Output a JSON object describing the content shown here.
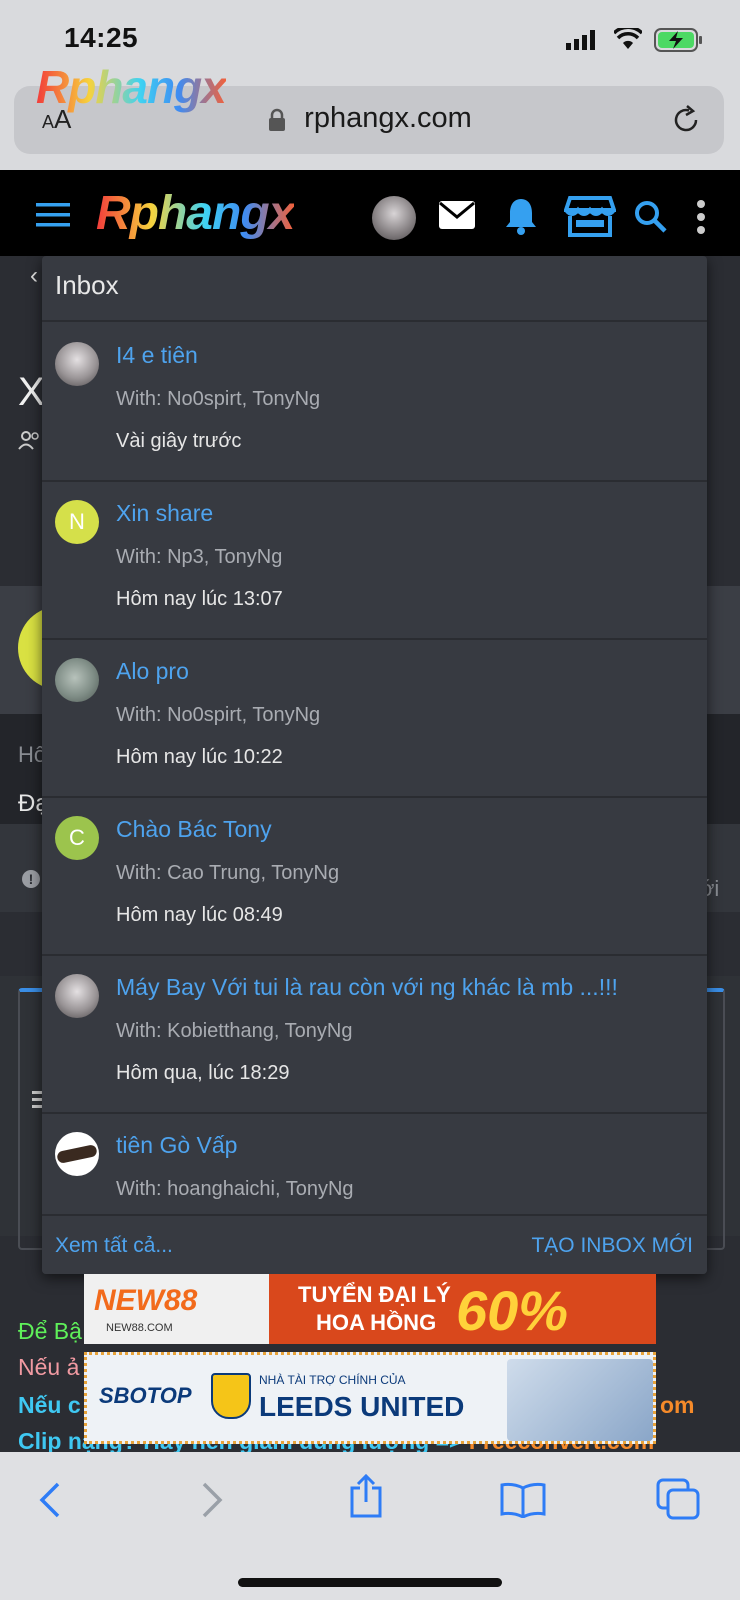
{
  "status_bar": {
    "time": "14:25"
  },
  "browser": {
    "text_size_label_small": "A",
    "text_size_label_large": "A",
    "domain": "rphangx.com",
    "logo_overlay": "Rphangx"
  },
  "site_header": {
    "logo": "Rphangx"
  },
  "background_page": {
    "title_fragment": "X",
    "line1_fragment": "Hô",
    "line2_fragment": "Đạ",
    "right_fragment": "ới",
    "text_green": "Để Bậ",
    "text_pink": "Nếu ả",
    "text_cyan": "Nếu c",
    "text_bottom_cyan": "Clip nặng? Hãy nén giảm dung lượng =>",
    "text_bottom_orange": "Freeconvert.com",
    "text_orange_right": "om"
  },
  "inbox": {
    "title": "Inbox",
    "messages": [
      {
        "title": "I4 e tiên",
        "with": "With: No0spirt, TonyNg",
        "time": "Vài giây trước",
        "avatar_type": "photo",
        "avatar_letter": "",
        "avatar_color": "#8e8a8c"
      },
      {
        "title": "Xin share",
        "with": "With: Np3, TonyNg",
        "time": "Hôm nay lúc 13:07",
        "avatar_type": "letter",
        "avatar_letter": "N",
        "avatar_color": "#d5e04a"
      },
      {
        "title": "Alo pro",
        "with": "With: No0spirt, TonyNg",
        "time": "Hôm nay lúc 10:22",
        "avatar_type": "photo",
        "avatar_letter": "",
        "avatar_color": "#7f8d86"
      },
      {
        "title": "Chào Bác Tony",
        "with": "With: Cao Trung, TonyNg",
        "time": "Hôm nay lúc 08:49",
        "avatar_type": "letter",
        "avatar_letter": "C",
        "avatar_color": "#9cc44d"
      },
      {
        "title": "Máy Bay Với tui là rau còn với ng khác là mb ...!!!",
        "with": "With: Kobietthang, TonyNg",
        "time": "Hôm qua, lúc 18:29",
        "avatar_type": "photo",
        "avatar_letter": "",
        "avatar_color": "#8e8a8c"
      },
      {
        "title": "tiên Gò Vấp",
        "with": "With: hoanghaichi, TonyNg",
        "time": "",
        "avatar_type": "logo",
        "avatar_letter": "",
        "avatar_color": "#ffffff"
      }
    ],
    "view_all": "Xem tất cả...",
    "new_inbox": "TẠO INBOX MỚI"
  },
  "ads": {
    "ad1_brand": "NEW88",
    "ad1_sub": "NEW88.COM",
    "ad1_line1": "TUYỂN ĐẠI LÝ",
    "ad1_line2": "HOA HỒNG",
    "ad1_percent": "60%",
    "ad2_brand": "SBOTOP",
    "ad2_sponsor": "NHÀ TÀI TRỢ CHÍNH CỦA",
    "ad2_club": "LEEDS UNITED"
  },
  "colors": {
    "link_blue": "#4ea3ee",
    "panel": "#373a41",
    "header_black": "#000000",
    "icon_blue": "#35a0f0"
  }
}
